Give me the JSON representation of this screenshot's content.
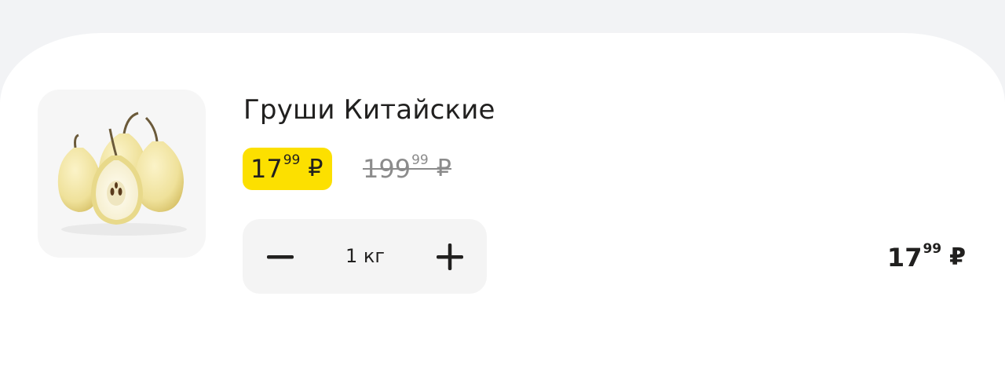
{
  "product": {
    "title": "Груши Китайские",
    "image_icon": "pear-image",
    "price": {
      "main": "17",
      "cents": "99",
      "currency": "₽"
    },
    "old_price": {
      "main": "199",
      "cents": "99",
      "currency": "₽"
    },
    "quantity_label": "1 кг",
    "total": {
      "main": "17",
      "cents": "99",
      "currency": "₽"
    }
  },
  "colors": {
    "badge": "#fce000",
    "text": "#21201f",
    "old_price": "#8b8b8b"
  }
}
